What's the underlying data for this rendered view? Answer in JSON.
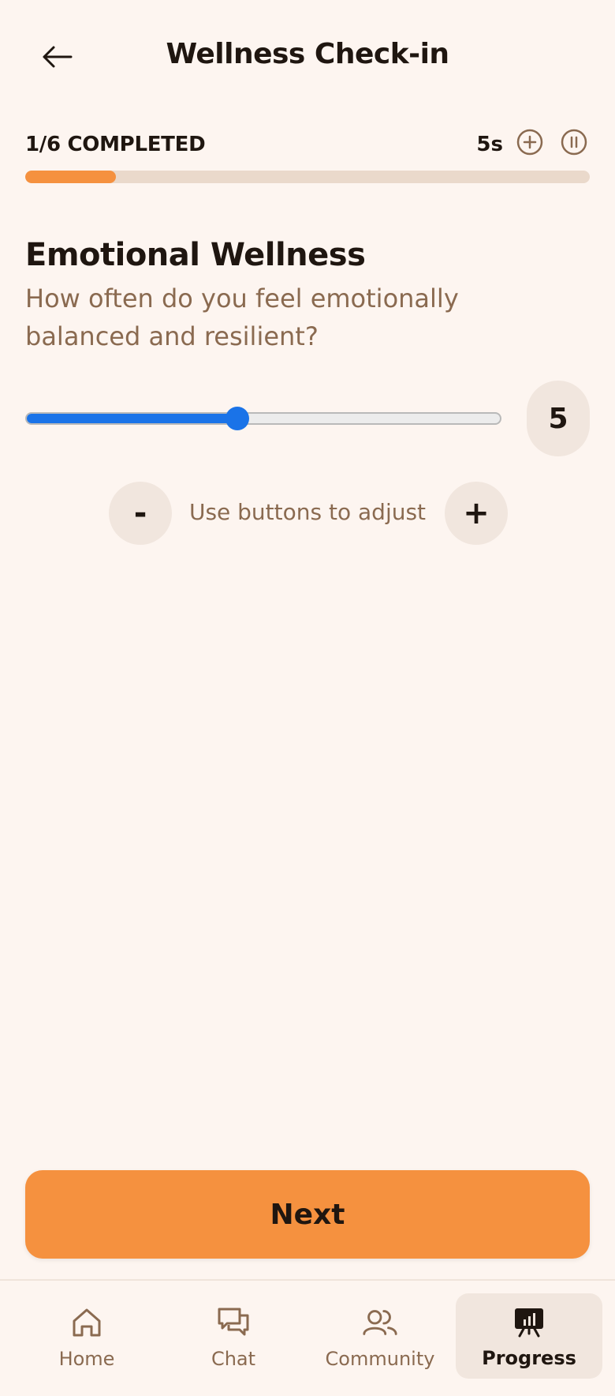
{
  "header": {
    "title": "Wellness Check-in",
    "back_icon": "arrow-left-icon"
  },
  "progress": {
    "label": "1/6 COMPLETED",
    "fraction": 0.16,
    "timer": "5s",
    "add_time_icon": "plus-circle-icon",
    "pause_icon": "pause-circle-icon",
    "accent": "#f5913f",
    "track_color": "#ead9cb"
  },
  "question": {
    "title": "Emotional Wellness",
    "text": "How often do you feel emotionally balanced and resilient?"
  },
  "slider": {
    "value": "5",
    "level": 0.445,
    "color": "#1a73e8"
  },
  "stepper": {
    "minus_label": "-",
    "plus_label": "+",
    "hint": "Use buttons to adjust"
  },
  "next_button": {
    "label": "Next",
    "color": "#f5913f"
  },
  "nav": {
    "items": [
      {
        "label": "Home",
        "icon": "home-icon",
        "active": false
      },
      {
        "label": "Chat",
        "icon": "chat-icon",
        "active": false
      },
      {
        "label": "Community",
        "icon": "community-icon",
        "active": false
      },
      {
        "label": "Progress",
        "icon": "progress-icon",
        "active": true
      }
    ]
  }
}
